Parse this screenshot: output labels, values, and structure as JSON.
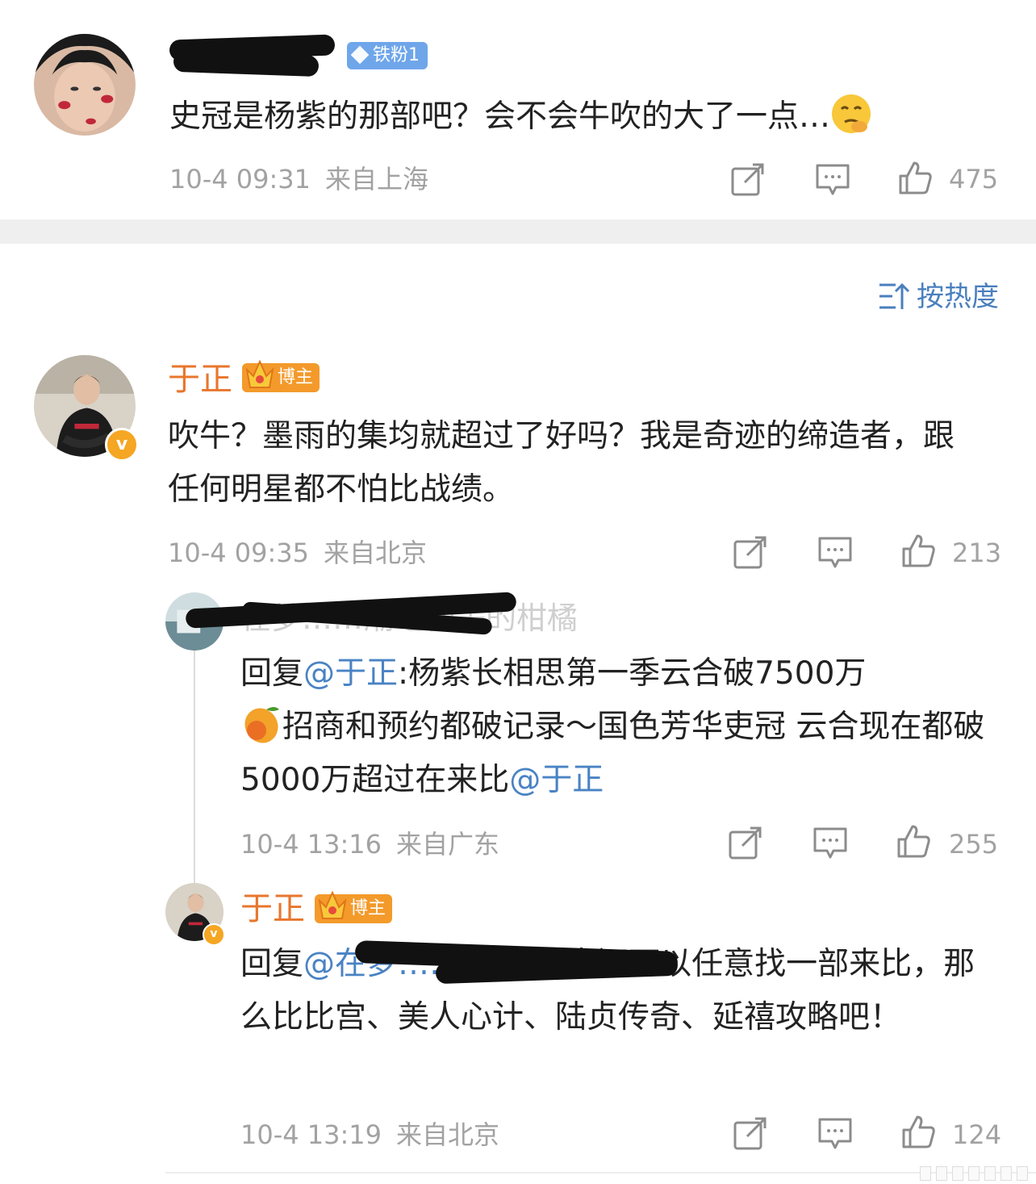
{
  "comment1": {
    "badge": "铁粉1",
    "text": "史冠是杨紫的那部吧？会不会牛吹的大了一点…",
    "time": "10-4 09:31",
    "location": "来自上海",
    "likes": "475"
  },
  "sort": {
    "label": "按热度"
  },
  "comment2": {
    "author": "于正",
    "badge": "博主",
    "text": "吹牛？墨雨的集均就超过了好吗？我是奇迹的缔造者，跟任何明星都不怕比战绩。",
    "time": "10-4 09:35",
    "location": "来自北京",
    "likes": "213"
  },
  "reply1": {
    "author_visible": "在梦……潮吃松子的柑橘",
    "text_prefix": "回复",
    "mention1": "@于正",
    "text_a": ":杨紫长相思第一季云合破7500万",
    "text_b": "招商和预约都破记录～国色芳华吏冠 云合现在都破5000万超过在来比",
    "mention2": "@于正",
    "time": "10-4 13:16",
    "location": "来自广东",
    "likes": "255"
  },
  "reply2": {
    "author": "于正",
    "badge": "博主",
    "text_prefix": "回复",
    "mention": "@在梦……柑橘",
    "text": ":原来还可以任意找一部来比，那么比比宫、美人心计、陆贞传奇、延禧攻略吧！",
    "time": "10-4 13:19",
    "location": "来自北京",
    "likes": "124"
  },
  "icons": [
    "share-icon",
    "comment-icon",
    "like-icon",
    "sort-icon",
    "crown-icon",
    "diamond-icon"
  ]
}
